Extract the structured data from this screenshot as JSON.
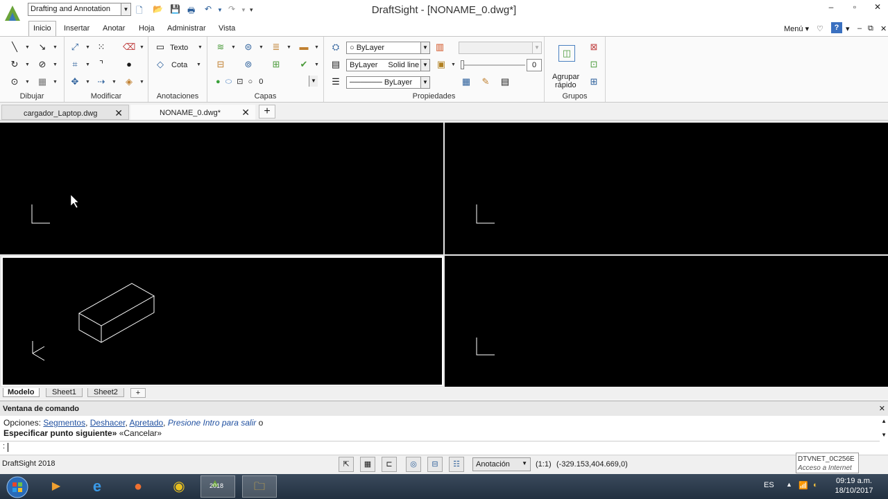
{
  "window": {
    "title": "DraftSight - [NONAME_0.dwg*]",
    "workspace": "Drafting and Annotation",
    "min": "–",
    "max": "▫",
    "close": "✕"
  },
  "tabs": [
    "Inicio",
    "Insertar",
    "Anotar",
    "Hoja",
    "Administrar",
    "Vista"
  ],
  "menu": {
    "label": "Menú ▾",
    "star": "♡",
    "help": "?",
    "tools": "▾",
    "min": "–",
    "restore": "⧉",
    "close": "✕"
  },
  "ribbon": {
    "groups": {
      "draw": "Dibujar",
      "modify": "Modificar",
      "annotations": "Anotaciones",
      "layers": "Capas",
      "properties": "Propiedades",
      "groups": "Grupos"
    },
    "text_label": "Texto",
    "dim_label": "Cota",
    "layer_combo": "0",
    "color_combo": "ByLayer",
    "linestyle_combo_a": "ByLayer",
    "linestyle_combo_b": "Solid line",
    "lineweight_combo": "ByLayer",
    "transparency_value": "0",
    "quick_group": {
      "line1": "Agrupar",
      "line2": "rápido"
    }
  },
  "doc_tabs": [
    {
      "label": "cargador_Laptop.dwg"
    },
    {
      "label": "NONAME_0.dwg*"
    }
  ],
  "doc_tab_close": "✕",
  "doc_tab_new": "+",
  "layout_tabs": [
    "Modelo",
    "Sheet1",
    "Sheet2"
  ],
  "layout_tab_new": "+",
  "command": {
    "title": "Ventana de comando",
    "close": "✕",
    "options_prefix": "Opciones:",
    "opt_segments": "Segmentos",
    "opt_undo": "Deshacer",
    "opt_tight": "Apretado",
    "opt_hint": "Presione Intro para salir",
    "opt_suffix": "o",
    "prompt_bold": "Especificar punto siguiente»",
    "prompt_rest": "«Cancelar»",
    "input_prefix": ":"
  },
  "status": {
    "app": "DraftSight 2018",
    "annotation": "Anotación",
    "scale": "(1:1)",
    "coords": "(-329.153,404.669,0)"
  },
  "tooltip": {
    "line1": "DTVNET_0C256E",
    "line2": "Acceso a Internet"
  },
  "taskbar": {
    "lang": "ES",
    "time": "09:19 a.m.",
    "date": "18/10/2017",
    "draftsight_label": "2018"
  },
  "colors": {
    "viewport_bg": "#000000",
    "ribbon_bg": "#fafafa",
    "link": "#2050a0"
  }
}
